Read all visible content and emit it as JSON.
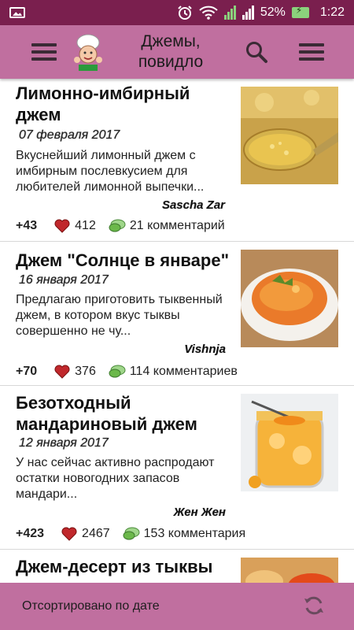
{
  "status_bar": {
    "battery": "52%",
    "time": "1:22",
    "icons": [
      "image-icon",
      "alarm-icon",
      "wifi-icon",
      "signal-icon",
      "battery-charging-icon"
    ]
  },
  "app_bar": {
    "title": "Джемы, повидло",
    "icons": [
      "menu-icon",
      "chef-logo",
      "search-icon",
      "more-menu-icon"
    ]
  },
  "colors": {
    "status_bar": "#7a1f4e",
    "app_bar": "#c06f9f",
    "heart": "#c0282c",
    "bubble": "#6bb84a"
  },
  "recipes": [
    {
      "title": "Лимонно-имбирный джем",
      "date": "07 февраля 2017",
      "description": "Вкуснейший лимонный джем с имбирным послевкусием для любителей лимонной выпечки...",
      "author": "Sascha Zar",
      "rating": "+43",
      "likes": "412",
      "comments": "21 комментарий"
    },
    {
      "title": "Джем \"Солнце в январе\"",
      "date": "16 января 2017",
      "description": "Предлагаю приготовить тыквенный джем, в котором вкус тыквы совершенно не чу...",
      "author": "Vishnja",
      "rating": "+70",
      "likes": "376",
      "comments": "114 комментариев"
    },
    {
      "title": "Безотходный мандариновый джем",
      "date": "12 января 2017",
      "description": "У нас сейчас активно распродают остатки новогодних запасов мандари...",
      "author": "Жен Жен",
      "rating": "+423",
      "likes": "2467",
      "comments": "153 комментария"
    },
    {
      "title": "Джем-десерт из тыквы"
    }
  ],
  "bottom_bar": {
    "sort_label": "Отсортировано по дате",
    "icon": "refresh-icon"
  }
}
